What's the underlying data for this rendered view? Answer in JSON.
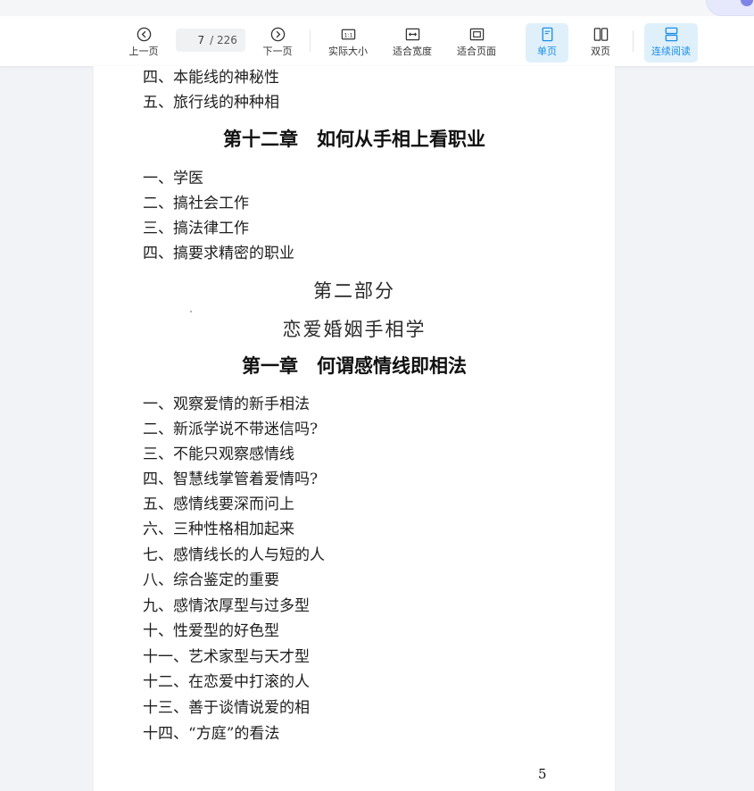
{
  "toolbar": {
    "prev_label": "上一页",
    "next_label": "下一页",
    "current_page": "7",
    "total_pages": "/ 226",
    "actual_size_label": "实际大小",
    "fit_width_label": "适合宽度",
    "fit_page_label": "适合页面",
    "single_page_label": "单页",
    "double_page_label": "双页",
    "continuous_label": "连续阅读",
    "accent_color": "#1b8fe6"
  },
  "document": {
    "lines_top": [
      "四、本能线的神秘性",
      "五、旅行线的种种相"
    ],
    "chapter12": "第十二章　如何从手相上看职业",
    "chapter12_items": [
      "一、学医",
      "二、搞社会工作",
      "三、搞法律工作",
      "四、搞要求精密的职业"
    ],
    "part_title": "第二部分",
    "part_subtitle": "恋爱婚姻手相学",
    "chapter1": "第一章　何谓感情线即相法",
    "chapter1_items": [
      "一、观察爱情的新手相法",
      "二、新派学说不带迷信吗?",
      "三、不能只观察感情线",
      "四、智慧线掌管着爱情吗?",
      "五、感情线要深而问上",
      "六、三种性格相加起来",
      "七、感情线长的人与短的人",
      "八、综合鉴定的重要",
      "九、感情浓厚型与过多型",
      "十、性爱型的好色型",
      "十一、艺术家型与天才型",
      "十二、在恋爱中打滚的人",
      "十三、善于谈情说爱的相",
      "十四、“方庭”的看法"
    ],
    "page_number": "5"
  }
}
